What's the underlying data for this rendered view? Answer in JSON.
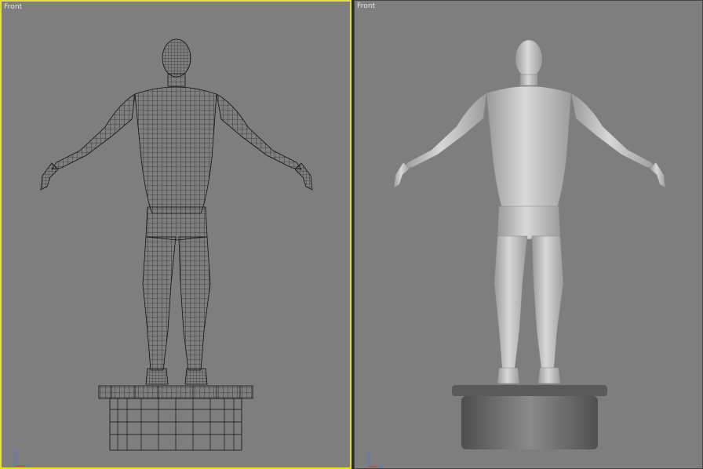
{
  "viewports": {
    "left": {
      "label": "Front",
      "shading": "wireframe",
      "active": true
    },
    "right": {
      "label": "Front",
      "shading": "smooth"
    }
  },
  "axis": {
    "z_label": "z",
    "x_label": "x"
  },
  "colors": {
    "viewport_bg": "#7e7e7e",
    "active_border": "#e8de3a",
    "wire": "#111111",
    "axis_z": "#4a7bd6",
    "axis_x": "#d23a2a"
  }
}
